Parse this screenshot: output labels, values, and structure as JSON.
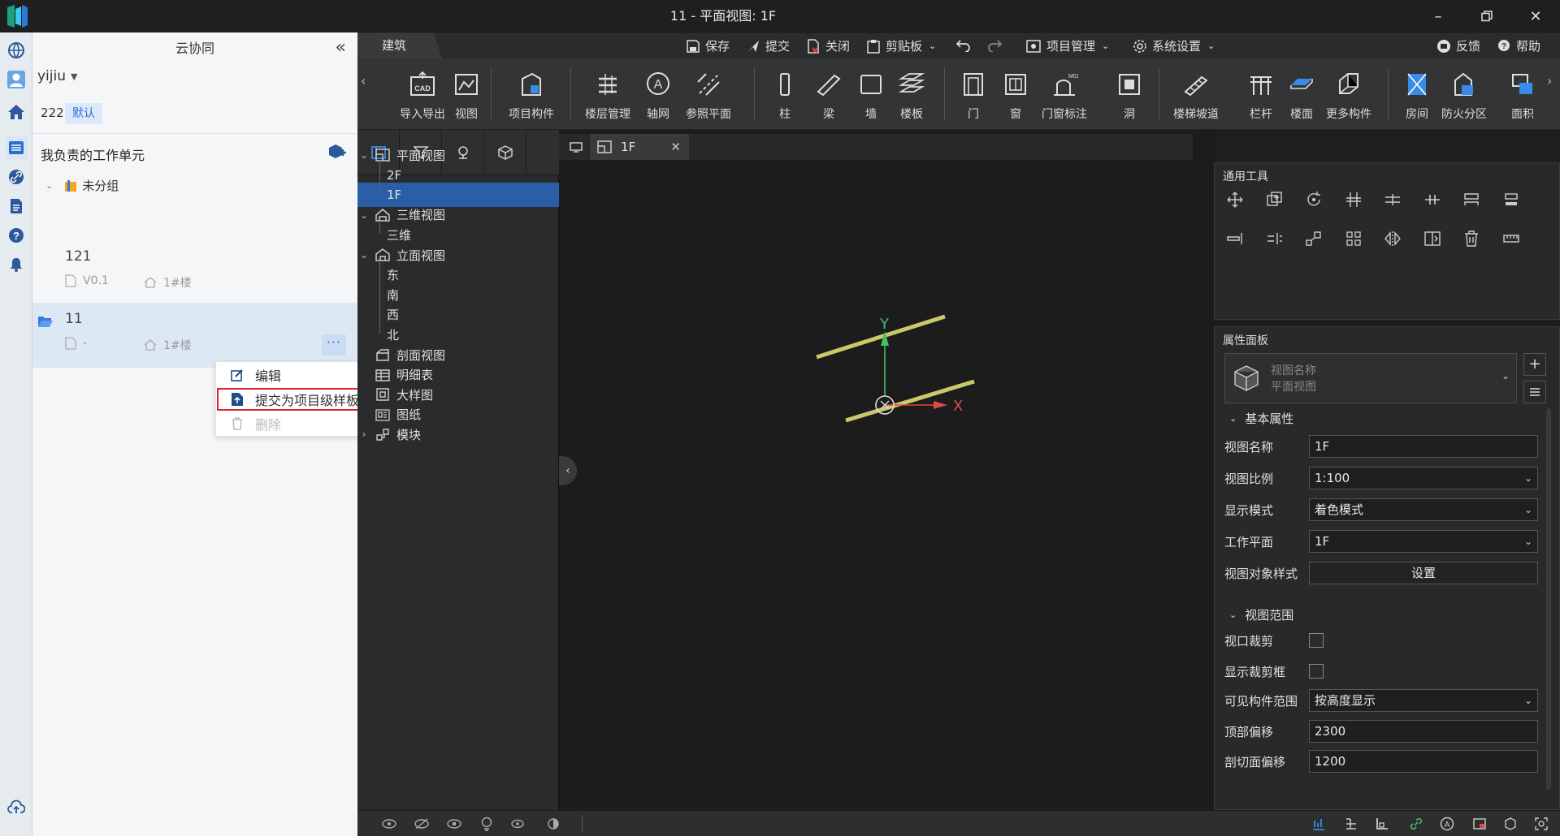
{
  "window": {
    "title": "11 - 平面视图: 1F"
  },
  "cloud": {
    "title": "云协同",
    "collapse_glyph": "«",
    "user": "yijiu",
    "project": {
      "number": "222",
      "badge": "默认"
    },
    "my_units_title": "我负责的工作单元",
    "group": "未分组",
    "units": [
      {
        "name": "121",
        "version": "V0.1",
        "floor": "1#楼"
      },
      {
        "name": "11",
        "version": "-",
        "floor": "1#楼"
      }
    ],
    "more_glyph": "···",
    "menu": [
      "编辑",
      "提交为项目级样板",
      "删除"
    ]
  },
  "ribbon": {
    "tab": "建筑",
    "quick": [
      "保存",
      "提交",
      "关闭",
      "剪贴板",
      "项目管理",
      "系统设置"
    ],
    "help": [
      "反馈",
      "帮助"
    ],
    "buttons": [
      "导入导出",
      "视图",
      "项目构件",
      "楼层管理",
      "轴网",
      "参照平面",
      "柱",
      "梁",
      "墙",
      "楼板",
      "门",
      "窗",
      "门窗标注",
      "洞",
      "楼梯坡道",
      "栏杆",
      "楼面",
      "更多构件",
      "房间",
      "防火分区",
      "面积"
    ]
  },
  "tree": {
    "nodes": [
      {
        "label": "平面视图",
        "level": 0,
        "arrow": "v"
      },
      {
        "label": "2F",
        "level": 1
      },
      {
        "label": "1F",
        "level": 1,
        "selected": true
      },
      {
        "label": "三维视图",
        "level": 0,
        "arrow": "v"
      },
      {
        "label": "三维",
        "level": 1
      },
      {
        "label": "立面视图",
        "level": 0,
        "arrow": "v"
      },
      {
        "label": "东",
        "level": 1
      },
      {
        "label": "南",
        "level": 1
      },
      {
        "label": "西",
        "level": 1
      },
      {
        "label": "北",
        "level": 1
      },
      {
        "label": "剖面视图",
        "level": 0
      },
      {
        "label": "明细表",
        "level": 0
      },
      {
        "label": "大样图",
        "level": 0
      },
      {
        "label": "图纸",
        "level": 0
      },
      {
        "label": "模块",
        "level": 0,
        "arrow": ">"
      }
    ]
  },
  "doc_tab": {
    "label": "1F"
  },
  "axis": {
    "x": "X",
    "y": "Y"
  },
  "tools_panel": {
    "title": "通用工具"
  },
  "props": {
    "title": "属性面板",
    "selector": {
      "line1": "视图名称",
      "line2": "平面视图"
    },
    "section_basic": "基本属性",
    "view_name_label": "视图名称",
    "view_name": "1F",
    "scale_label": "视图比例",
    "scale": "1:100",
    "display_label": "显示模式",
    "display": "着色模式",
    "workplane_label": "工作平面",
    "workplane": "1F",
    "style_label": "视图对象样式",
    "style_btn": "设置",
    "section_range": "视图范围",
    "crop_label": "视口裁剪",
    "crop_box_label": "显示裁剪框",
    "visible_label": "可见构件范围",
    "visible": "按高度显示",
    "top_label": "顶部偏移",
    "top": "2300",
    "cut_label": "剖切面偏移",
    "cut": "1200"
  },
  "colors": {
    "accent": "#2a5ea8",
    "highlight": "#d8262e",
    "beam": "#c9c86a",
    "y_axis": "#3fbf5f",
    "x_axis": "#e04848"
  }
}
